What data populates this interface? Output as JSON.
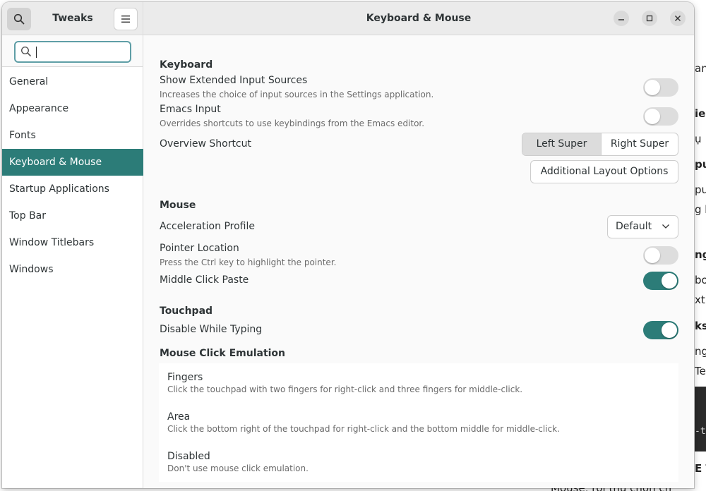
{
  "background_window": {
    "fragments": [
      "an",
      "ieg",
      "ụ",
      "pu",
      "pu",
      "g b",
      "ng",
      "bo",
      "xt s",
      "ks",
      "ng",
      "Te",
      "-t",
      "E T",
      "Mouse, rồi thụ chọn ch"
    ]
  },
  "sidebar": {
    "app_title": "Tweaks",
    "search_value": "",
    "items": [
      {
        "label": "General"
      },
      {
        "label": "Appearance"
      },
      {
        "label": "Fonts"
      },
      {
        "label": "Keyboard & Mouse"
      },
      {
        "label": "Startup Applications"
      },
      {
        "label": "Top Bar"
      },
      {
        "label": "Window Titlebars"
      },
      {
        "label": "Windows"
      }
    ],
    "selected_index": 3
  },
  "header": {
    "title": "Keyboard & Mouse"
  },
  "keyboard": {
    "section": "Keyboard",
    "extended_sources": {
      "label": "Show Extended Input Sources",
      "description": "Increases the choice of input sources in the Settings application.",
      "enabled": false
    },
    "emacs": {
      "label": "Emacs Input",
      "description": "Overrides shortcuts to use keybindings from the Emacs editor.",
      "enabled": false
    },
    "overview": {
      "label": "Overview Shortcut",
      "options": [
        "Left Super",
        "Right Super"
      ],
      "selected": "Left Super"
    },
    "layout_button": "Additional Layout Options"
  },
  "mouse": {
    "section": "Mouse",
    "acceleration": {
      "label": "Acceleration Profile",
      "value": "Default"
    },
    "pointer_location": {
      "label": "Pointer Location",
      "description": "Press the Ctrl key to highlight the pointer.",
      "enabled": false
    },
    "middle_click": {
      "label": "Middle Click Paste",
      "enabled": true
    }
  },
  "touchpad": {
    "section": "Touchpad",
    "disable_typing": {
      "label": "Disable While Typing",
      "enabled": true
    }
  },
  "emulation": {
    "section": "Mouse Click Emulation",
    "options": [
      {
        "title": "Fingers",
        "description": "Click the touchpad with two fingers for right-click and three fingers for middle-click."
      },
      {
        "title": "Area",
        "description": "Click the bottom right of the touchpad for right-click and the bottom middle for middle-click."
      },
      {
        "title": "Disabled",
        "description": "Don't use mouse click emulation."
      }
    ]
  },
  "colors": {
    "accent": "#2c7c78",
    "switch_off": "#dddddd"
  },
  "icons": {
    "search": "search-icon",
    "menu": "hamburger-menu-icon",
    "minimize": "minimize-icon",
    "maximize": "maximize-icon",
    "close": "close-icon",
    "dropdown": "chevron-down-icon"
  }
}
